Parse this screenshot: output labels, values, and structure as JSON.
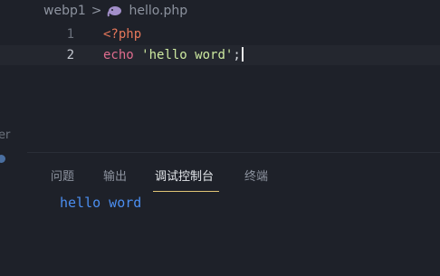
{
  "breadcrumb": {
    "folder": "webp1",
    "separator": ">",
    "file": "hello.php",
    "file_icon": "elephant-icon"
  },
  "editor": {
    "lines": [
      {
        "number": "1",
        "tokens": {
          "t1": "<?php"
        }
      },
      {
        "number": "2",
        "tokens": {
          "t1": "echo",
          "t2": " ",
          "t3": "'hello word'",
          "t4": ";"
        }
      }
    ]
  },
  "sidebar_fragment": "er",
  "panel": {
    "tabs": [
      "问题",
      "输出",
      "调试控制台",
      "终端"
    ],
    "active_tab": "调试控制台",
    "output": "hello word"
  },
  "colors": {
    "background": "#1e2129",
    "tab_underline": "#e0c575",
    "output_text": "#4b8ef0"
  }
}
